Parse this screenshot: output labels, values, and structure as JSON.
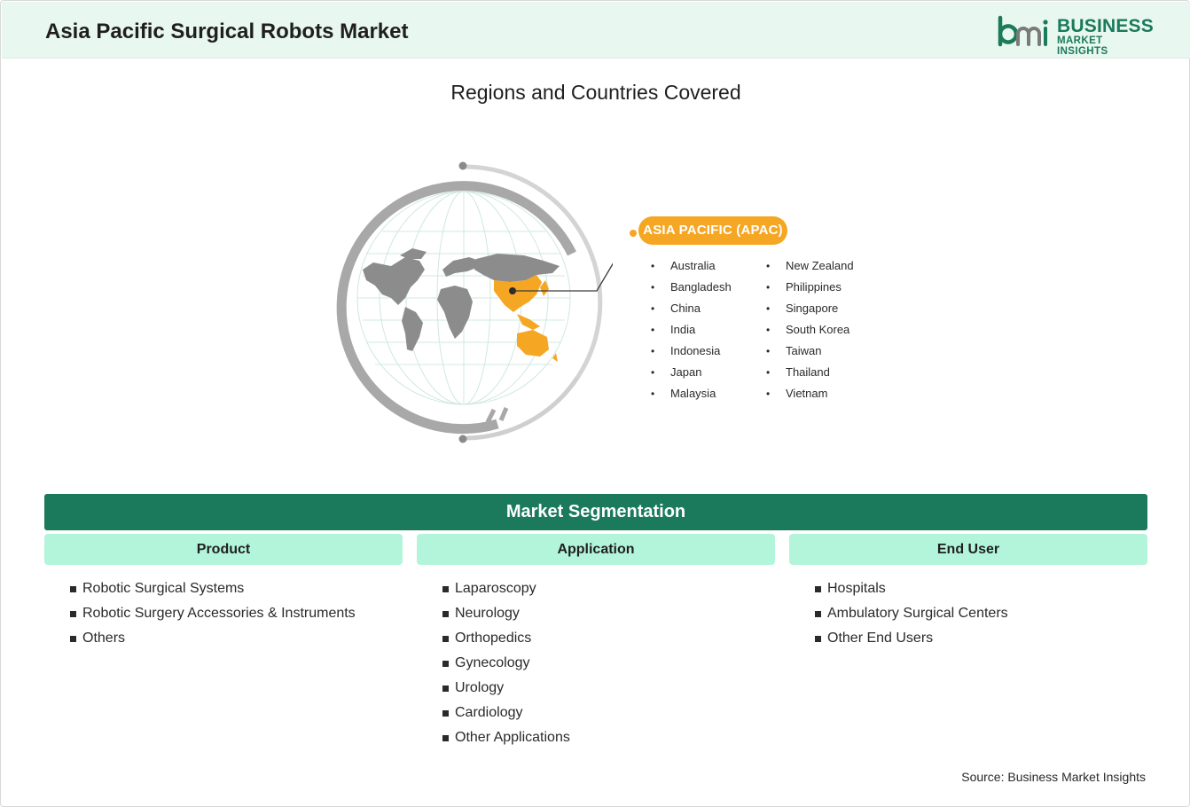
{
  "header": {
    "title": "Asia Pacific Surgical Robots Market",
    "logo": {
      "line1": "BUSINESS",
      "line2": "MARKET INSIGHTS",
      "icon": "bmi-logo-icon"
    }
  },
  "regions": {
    "title": "Regions and Countries Covered",
    "region_label": "ASIA PACIFIC (APAC)",
    "countries_col1": [
      "Australia",
      "Bangladesh",
      "China",
      "India",
      "Indonesia",
      "Japan",
      "Malaysia"
    ],
    "countries_col2": [
      "New Zealand",
      "Philippines",
      "Singapore",
      "South Korea",
      "Taiwan",
      "Thailand",
      "Vietnam"
    ]
  },
  "segmentation": {
    "title": "Market Segmentation",
    "columns": [
      {
        "header": "Product",
        "items": [
          "Robotic Surgical Systems",
          "Robotic Surgery Accessories & Instruments",
          "Others"
        ]
      },
      {
        "header": "Application",
        "items": [
          "Laparoscopy",
          "Neurology",
          "Orthopedics",
          "Gynecology",
          "Urology",
          "Cardiology",
          "Other Applications"
        ]
      },
      {
        "header": "End User",
        "items": [
          "Hospitals",
          "Ambulatory Surgical Centers",
          "Other End Users"
        ]
      }
    ]
  },
  "source": "Source: Business Market Insights",
  "colors": {
    "brand_green": "#1a7a5b",
    "accent_orange": "#f5a623",
    "header_bg": "#e8f7f0",
    "subhead_bg": "#b3f5da",
    "globe_gray": "#a8a8a8"
  }
}
